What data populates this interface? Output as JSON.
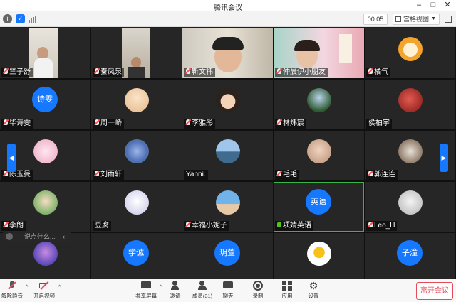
{
  "window": {
    "title": "腾讯会议"
  },
  "toolbar": {
    "timer": "00:05",
    "view_label": "宫格视图"
  },
  "tiles": [
    {
      "name": "竺子舒",
      "kind": "video"
    },
    {
      "name": "秦凤泉",
      "kind": "video"
    },
    {
      "name": "靳文祎",
      "kind": "video"
    },
    {
      "name": "仲晨伊小朋友",
      "kind": "video"
    },
    {
      "name": "橘气",
      "kind": "photo"
    },
    {
      "name": "毕诗雯",
      "kind": "text",
      "avatar_text": "诗雯"
    },
    {
      "name": "周一峤",
      "kind": "photo"
    },
    {
      "name": "李雅彤",
      "kind": "photo"
    },
    {
      "name": "林炜宸",
      "kind": "photo"
    },
    {
      "name": "侯柏宇",
      "kind": "photo"
    },
    {
      "name": "陈玉曼",
      "kind": "photo"
    },
    {
      "name": "刘雨轩",
      "kind": "photo"
    },
    {
      "name": "Yanni.",
      "kind": "photo"
    },
    {
      "name": "毛毛",
      "kind": "photo"
    },
    {
      "name": "郭连连",
      "kind": "photo"
    },
    {
      "name": "李朗",
      "kind": "photo"
    },
    {
      "name": "豆腐",
      "kind": "photo"
    },
    {
      "name": "幸福小妮子",
      "kind": "photo"
    },
    {
      "name": "项婧英语",
      "kind": "text",
      "avatar_text": "英语",
      "active": true
    },
    {
      "name": "Leo_H",
      "kind": "photo"
    },
    {
      "name": "",
      "kind": "photo"
    },
    {
      "name": "",
      "kind": "text",
      "avatar_text": "学诚"
    },
    {
      "name": "",
      "kind": "text",
      "avatar_text": "玥萱"
    },
    {
      "name": "",
      "kind": "photo"
    },
    {
      "name": "",
      "kind": "text",
      "avatar_text": "子潼"
    }
  ],
  "chat": {
    "placeholder": "说点什么..."
  },
  "bottom": {
    "unmute": "解除静音",
    "video": "开启视频",
    "share": "共享屏幕",
    "invite": "邀请",
    "members": "成员(31)",
    "chat": "聊天",
    "record": "录制",
    "apps": "应用",
    "settings": "设置",
    "leave": "离开会议"
  },
  "colors": {
    "accent": "#1677ff",
    "leave": "#e34d59",
    "active_border": "#39b54a"
  }
}
